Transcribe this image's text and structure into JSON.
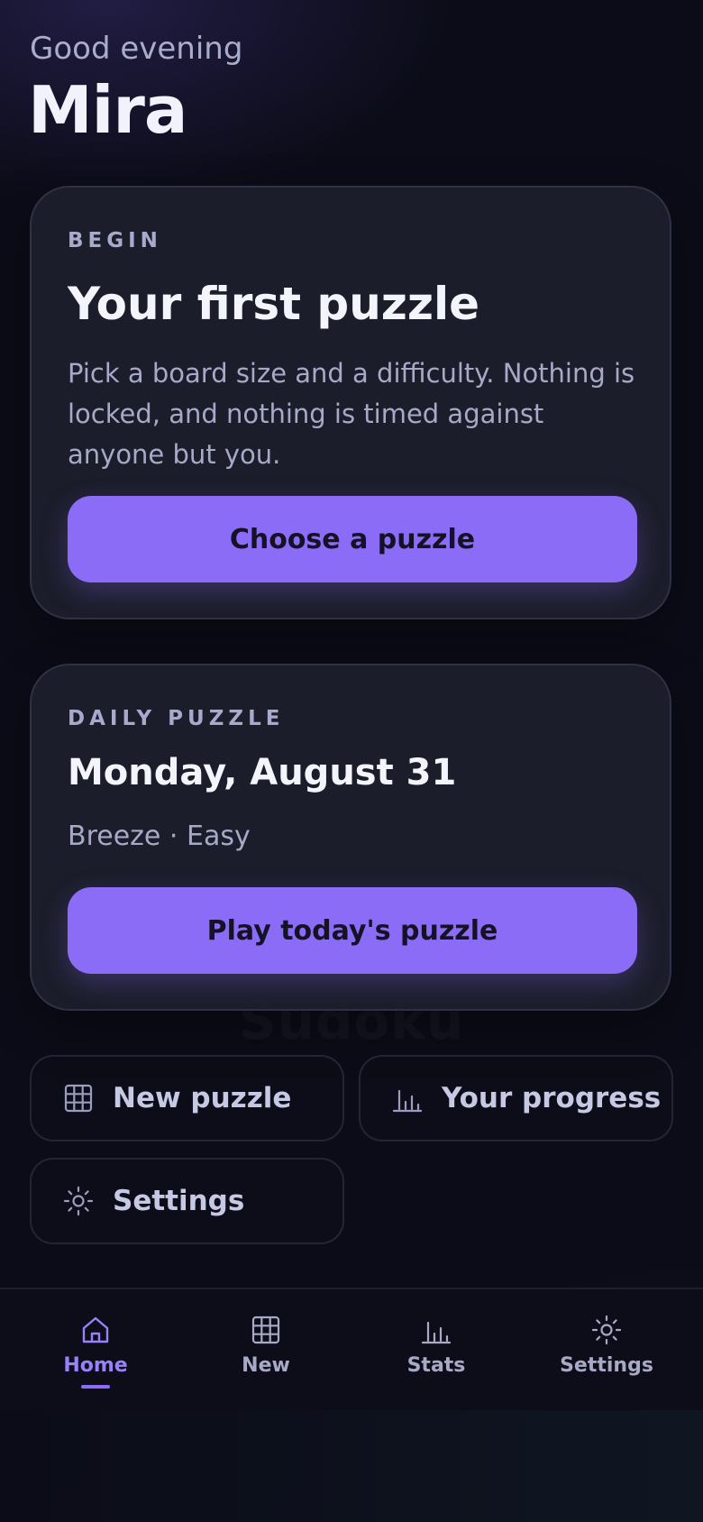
{
  "greeting": "Good evening",
  "username": "Mira",
  "first_puzzle_card": {
    "eyebrow": "BEGIN",
    "title": "Your first puzzle",
    "body": "Pick a board size and a difficulty. Nothing is locked, and nothing is timed against anyone but you.",
    "button_label": "Choose a puzzle"
  },
  "daily_card": {
    "eyebrow": "DAILY PUZZLE",
    "date": "Monday, August 31",
    "meta": "Breeze · Easy",
    "button_label": "Play today's puzzle"
  },
  "background_watermark": "Sudoku",
  "quick_actions": [
    {
      "label": "New puzzle",
      "icon": "grid-icon"
    },
    {
      "label": "Your progress",
      "icon": "bar-chart-icon"
    },
    {
      "label": "Settings",
      "icon": "sun-gear-icon"
    }
  ],
  "bottom_nav": {
    "items": [
      {
        "label": "Home",
        "icon": "home-icon",
        "active": true
      },
      {
        "label": "New",
        "icon": "grid-icon",
        "active": false
      },
      {
        "label": "Stats",
        "icon": "bar-chart-icon",
        "active": false
      },
      {
        "label": "Settings",
        "icon": "sun-gear-icon",
        "active": false
      }
    ]
  },
  "colors": {
    "accent": "#8a6cf7",
    "active_nav_text": "#9a80fb",
    "background": "#0b0c17",
    "card": "#1e202e",
    "muted_text": "#a6a9c7"
  }
}
